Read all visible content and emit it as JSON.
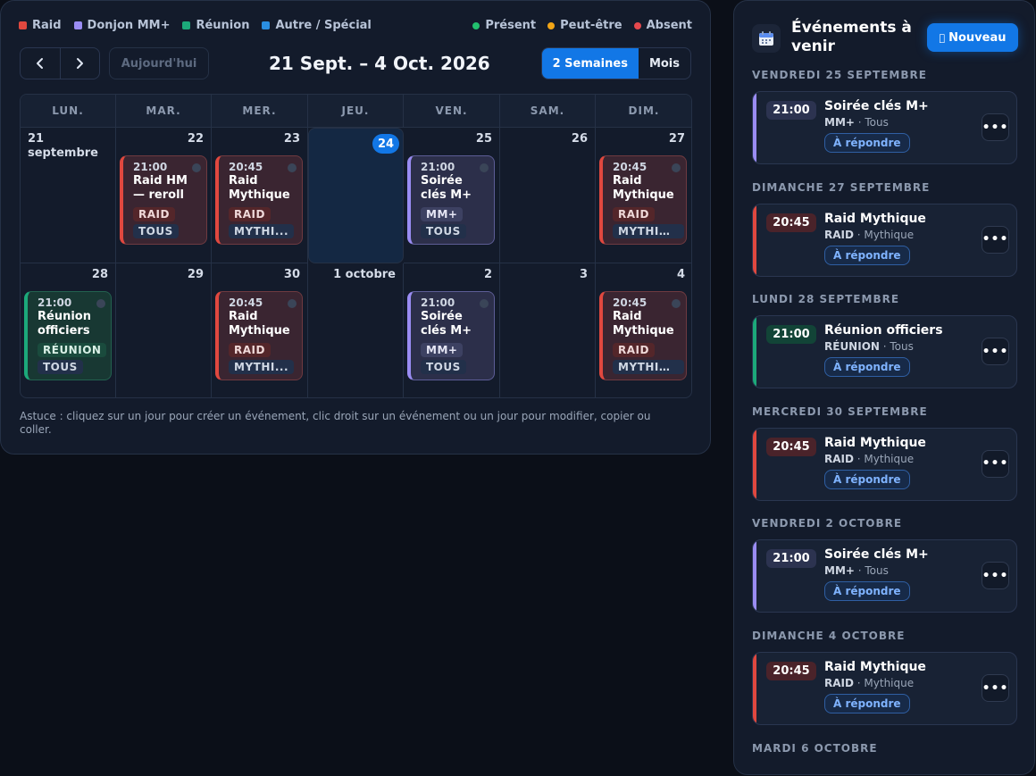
{
  "legend": {
    "categories": [
      {
        "label": "Raid",
        "color": "#e0483f"
      },
      {
        "label": "Donjon MM+",
        "color": "#9a8cf3"
      },
      {
        "label": "Réunion",
        "color": "#1ca97a"
      },
      {
        "label": "Autre / Spécial",
        "color": "#2a8ee0"
      }
    ],
    "statuses": [
      {
        "label": "Présent",
        "color": "#22c06e"
      },
      {
        "label": "Peut-être",
        "color": "#f2a516"
      },
      {
        "label": "Absent",
        "color": "#e5484d"
      }
    ]
  },
  "toolbar": {
    "today_label": "Aujourd'hui",
    "range_title": "21 Sept. – 4 Oct. 2026",
    "view_two_weeks": "2 Semaines",
    "view_month": "Mois"
  },
  "weekdays": [
    "LUN.",
    "MAR.",
    "MER.",
    "JEU.",
    "VEN.",
    "SAM.",
    "DIM."
  ],
  "days": [
    {
      "label": "21 septembre"
    },
    {
      "label": "22"
    },
    {
      "label": "23"
    },
    {
      "label": "24",
      "today": true
    },
    {
      "label": "25"
    },
    {
      "label": "26"
    },
    {
      "label": "27"
    },
    {
      "label": "28"
    },
    {
      "label": "29"
    },
    {
      "label": "30"
    },
    {
      "label": "1 octobre"
    },
    {
      "label": "2"
    },
    {
      "label": "3"
    },
    {
      "label": "4"
    }
  ],
  "events": [
    {
      "day": 1,
      "kind": "raid",
      "time": "21:00",
      "title": "Raid HM — reroll",
      "tag": "RAID",
      "audience": "TOUS"
    },
    {
      "day": 2,
      "kind": "raid",
      "time": "20:45",
      "title": "Raid Mythique",
      "tag": "RAID",
      "audience": "MYTHI..."
    },
    {
      "day": 4,
      "kind": "mm",
      "time": "21:00",
      "title": "Soirée clés M+",
      "tag": "MM+",
      "audience": "TOUS"
    },
    {
      "day": 6,
      "kind": "raid",
      "time": "20:45",
      "title": "Raid Mythique",
      "tag": "RAID",
      "audience": "MYTHIQ..."
    },
    {
      "day": 7,
      "kind": "reu",
      "time": "21:00",
      "title": "Réunion officiers",
      "tag": "RÉUNION",
      "audience": "TOUS"
    },
    {
      "day": 9,
      "kind": "raid",
      "time": "20:45",
      "title": "Raid Mythique",
      "tag": "RAID",
      "audience": "MYTHI..."
    },
    {
      "day": 11,
      "kind": "mm",
      "time": "21:00",
      "title": "Soirée clés M+",
      "tag": "MM+",
      "audience": "TOUS"
    },
    {
      "day": 13,
      "kind": "raid",
      "time": "20:45",
      "title": "Raid Mythique",
      "tag": "RAID",
      "audience": "MYTHIQ..."
    }
  ],
  "hint": "Astuce : cliquez sur un jour pour créer un événement, clic droit sur un événement ou un jour pour modifier, copier ou coller.",
  "sidebar": {
    "icon": "calendar-icon",
    "title": "Événements à venir",
    "new_button": "Nouveau",
    "groups": [
      {
        "date": "VENDREDI 25 SEPTEMBRE",
        "kind": "mm",
        "time": "21:00",
        "title": "Soirée clés M+",
        "tag": "MM+",
        "audience": "Tous",
        "action": "À répondre"
      },
      {
        "date": "DIMANCHE 27 SEPTEMBRE",
        "kind": "raid",
        "time": "20:45",
        "title": "Raid Mythique",
        "tag": "RAID",
        "audience": "Mythique",
        "action": "À répondre"
      },
      {
        "date": "LUNDI 28 SEPTEMBRE",
        "kind": "reu",
        "time": "21:00",
        "title": "Réunion officiers",
        "tag": "RÉUNION",
        "audience": "Tous",
        "action": "À répondre"
      },
      {
        "date": "MERCREDI 30 SEPTEMBRE",
        "kind": "raid",
        "time": "20:45",
        "title": "Raid Mythique",
        "tag": "RAID",
        "audience": "Mythique",
        "action": "À répondre"
      },
      {
        "date": "VENDREDI 2 OCTOBRE",
        "kind": "mm",
        "time": "21:00",
        "title": "Soirée clés M+",
        "tag": "MM+",
        "audience": "Tous",
        "action": "À répondre"
      },
      {
        "date": "DIMANCHE 4 OCTOBRE",
        "kind": "raid",
        "time": "20:45",
        "title": "Raid Mythique",
        "tag": "RAID",
        "audience": "Mythique",
        "action": "À répondre"
      }
    ],
    "trailing_date": "MARDI 6 OCTOBRE"
  }
}
